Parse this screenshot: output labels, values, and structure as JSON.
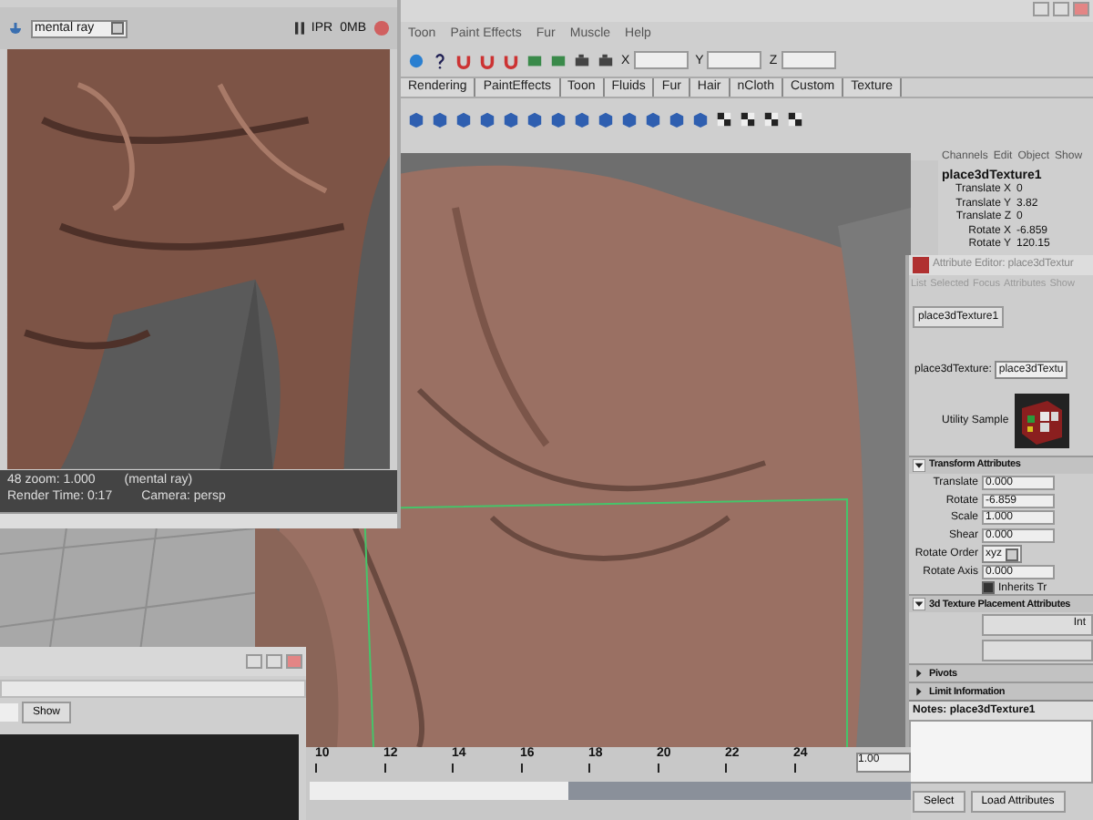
{
  "main_window": {
    "menu": [
      "Toon",
      "Paint Effects",
      "Fur",
      "Muscle",
      "Help"
    ],
    "xyz_fields": [
      "X",
      "Y",
      "Z"
    ],
    "shelf_tabs": [
      "Rendering",
      "PaintEffects",
      "Toon",
      "Fluids",
      "Fur",
      "Hair",
      "nCloth",
      "Custom",
      "Texture"
    ]
  },
  "render_view": {
    "renderer": "mental ray",
    "ipr": "IPR",
    "memory": "0MB",
    "status_lines": [
      [
        "48  zoom: 1.000",
        "(mental ray)"
      ],
      [
        "Render Time: 0:17",
        "Camera: persp"
      ]
    ]
  },
  "channel_box": {
    "menu": [
      "Channels",
      "Edit",
      "Object",
      "Show"
    ],
    "node": "place3dTexture1",
    "rows": [
      {
        "label": "Translate X",
        "value": "0"
      },
      {
        "label": "Translate Y",
        "value": "3.82"
      },
      {
        "label": "Translate Z",
        "value": "0"
      },
      {
        "label": "Rotate X",
        "value": "-6.859"
      },
      {
        "label": "Rotate Y",
        "value": "120.15"
      }
    ]
  },
  "attribute_editor": {
    "title": "Attribute Editor: place3dTextur",
    "menu": [
      "List",
      "Selected",
      "Focus",
      "Attributes",
      "Show"
    ],
    "tab": "place3dTexture1",
    "node_label": "place3dTexture:",
    "node_value": "place3dTextu",
    "sample_label": "Utility Sample",
    "sections": [
      {
        "title": "Transform Attributes",
        "expanded": true,
        "rows": [
          {
            "kind": "field",
            "label": "Translate",
            "value": "0.000"
          },
          {
            "kind": "field",
            "label": "Rotate",
            "value": "-6.859"
          },
          {
            "kind": "field",
            "label": "Scale",
            "value": "1.000"
          },
          {
            "kind": "field",
            "label": "Shear",
            "value": "0.000"
          },
          {
            "kind": "dropdown",
            "label": "Rotate Order",
            "value": "xyz"
          },
          {
            "kind": "field",
            "label": "Rotate Axis",
            "value": "0.000"
          },
          {
            "kind": "checkbox",
            "label": "Inherits Tr",
            "checked": true
          }
        ]
      },
      {
        "title": "3d Texture Placement Attributes",
        "expanded": true,
        "rows": [
          {
            "kind": "button",
            "label": "Int"
          },
          {
            "kind": "button"
          }
        ]
      },
      {
        "title": "Pivots",
        "expanded": false
      },
      {
        "title": "Limit Information",
        "expanded": false
      }
    ],
    "notes_label": "Notes:  place3dTexture1",
    "buttons": [
      "Select",
      "Load Attributes"
    ]
  },
  "script_window": {
    "show_button": "Show"
  },
  "time_slider": {
    "ticks": [
      "10",
      "12",
      "14",
      "16",
      "18",
      "20",
      "22",
      "24"
    ],
    "current": "1.00",
    "range": {
      "level": 0.43
    }
  }
}
